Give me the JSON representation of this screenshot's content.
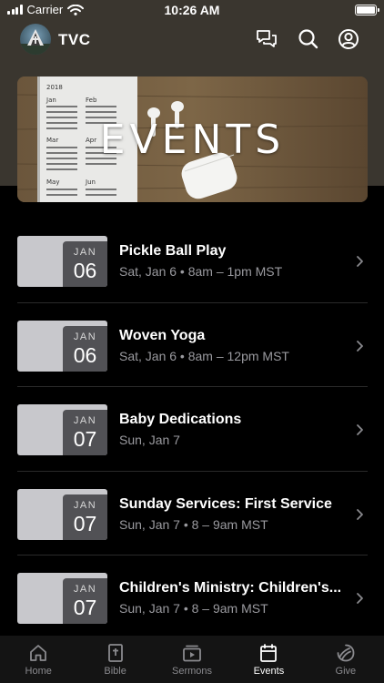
{
  "status_bar": {
    "carrier": "Carrier",
    "time": "10:26 AM"
  },
  "app": {
    "name": "TVC"
  },
  "hero": {
    "title": "EVENTS"
  },
  "events": [
    {
      "month": "JAN",
      "day": "06",
      "title": "Pickle Ball Play",
      "subtitle": "Sat, Jan 6 • 8am – 1pm MST"
    },
    {
      "month": "JAN",
      "day": "06",
      "title": "Woven Yoga",
      "subtitle": "Sat, Jan 6 • 8am – 12pm MST"
    },
    {
      "month": "JAN",
      "day": "07",
      "title": "Baby Dedications",
      "subtitle": "Sun, Jan 7"
    },
    {
      "month": "JAN",
      "day": "07",
      "title": "Sunday Services: First Service",
      "subtitle": "Sun, Jan 7 • 8 – 9am MST"
    },
    {
      "month": "JAN",
      "day": "07",
      "title": "Children's Ministry: Children's...",
      "subtitle": "Sun, Jan 7 • 8 – 9am MST"
    }
  ],
  "tabs": [
    {
      "label": "Home",
      "icon": "home-icon",
      "active": false
    },
    {
      "label": "Bible",
      "icon": "bible-icon",
      "active": false
    },
    {
      "label": "Sermons",
      "icon": "sermons-icon",
      "active": false
    },
    {
      "label": "Events",
      "icon": "calendar-icon",
      "active": true
    },
    {
      "label": "Give",
      "icon": "give-icon",
      "active": false
    }
  ]
}
